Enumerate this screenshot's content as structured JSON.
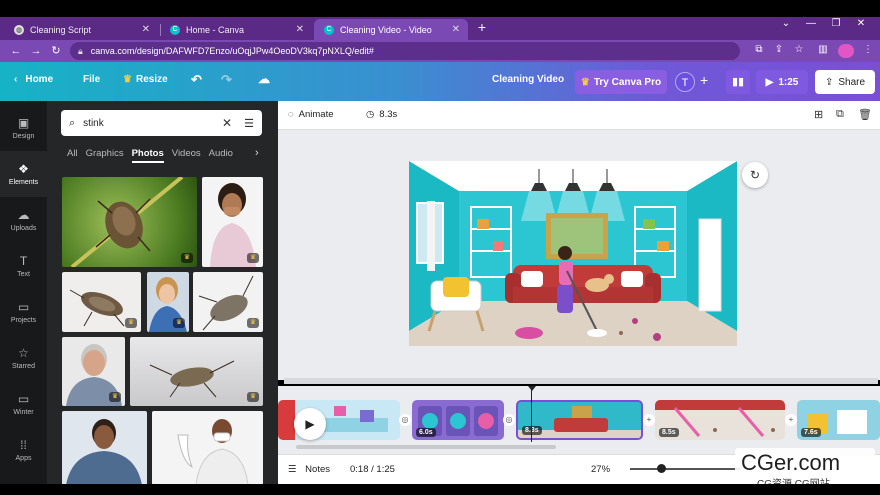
{
  "browser": {
    "tabs": [
      {
        "title": "Cleaning Script",
        "active": false
      },
      {
        "title": "Home - Canva",
        "active": false
      },
      {
        "title": "Cleaning Video - Video",
        "active": true
      }
    ],
    "url": "canva.com/design/DAFWFD7Enzo/uOqjJPw4OeoDV3kq7pNXLQ/edit#"
  },
  "header": {
    "home": "Home",
    "file": "File",
    "resize": "Resize",
    "doc_title": "Cleaning Video",
    "try_pro": "Try Canva Pro",
    "avatar_letter": "T",
    "play_duration": "1:25",
    "share": "Share"
  },
  "rail": [
    {
      "label": "Design",
      "icon": "design-icon",
      "glyph": "▣"
    },
    {
      "label": "Elements",
      "icon": "elements-icon",
      "glyph": "❖"
    },
    {
      "label": "Uploads",
      "icon": "upload-icon",
      "glyph": "☁"
    },
    {
      "label": "Text",
      "icon": "text-icon",
      "glyph": "T"
    },
    {
      "label": "Projects",
      "icon": "folder-icon",
      "glyph": "▭"
    },
    {
      "label": "Starred",
      "icon": "star-icon",
      "glyph": "☆"
    },
    {
      "label": "Winter",
      "icon": "folder-icon",
      "glyph": "▭"
    },
    {
      "label": "Apps",
      "icon": "apps-icon",
      "glyph": "⁞⁞"
    }
  ],
  "panel": {
    "search_value": "stink",
    "categories": [
      "All",
      "Graphics",
      "Photos",
      "Videos",
      "Audio"
    ],
    "active_category": "Photos"
  },
  "editor_toolbar": {
    "animate": "Animate",
    "duration": "8.3s"
  },
  "timeline": {
    "clips": [
      {
        "label": "",
        "color": "#c9e8f5"
      },
      {
        "label": "6.0s",
        "color": "#8a6bd1"
      },
      {
        "label": "8.3s",
        "color": "#2fb9c9"
      },
      {
        "label": "8.5s",
        "color": "#e9e2da"
      },
      {
        "label": "7.6s",
        "color": "#f2d96b"
      }
    ]
  },
  "footer": {
    "notes": "Notes",
    "time": "0:18 / 1:25",
    "zoom": "27%"
  },
  "watermark": {
    "line1": "CGer.com",
    "line2": "CG资源 CG网站"
  },
  "colors": {
    "tabstrip": "#5a2a86",
    "accent_teal": "#16b3c6",
    "accent_purple": "#7a4fd6",
    "panel_bg": "#252627",
    "rail_bg": "#18191b"
  }
}
